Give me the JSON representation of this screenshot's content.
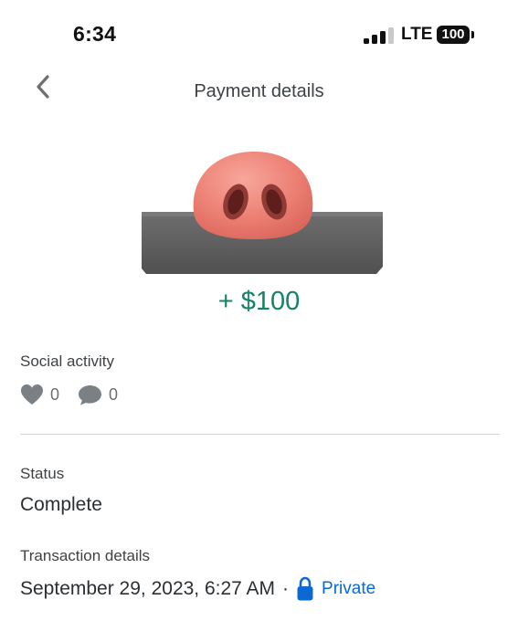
{
  "status_bar": {
    "time": "6:34",
    "network": "LTE",
    "battery": "100",
    "signal_bars_active": 3,
    "signal_bars_total": 4
  },
  "header": {
    "back_icon": "chevron-left-icon",
    "title": "Payment details"
  },
  "payment": {
    "amount": "+ $100",
    "amount_color": "#148467",
    "illustration": "pig-nose-icon"
  },
  "social": {
    "label": "Social activity",
    "likes_icon": "heart-icon",
    "likes": "0",
    "comments_icon": "comment-icon",
    "comments": "0"
  },
  "status": {
    "label": "Status",
    "value": "Complete"
  },
  "transaction": {
    "label": "Transaction details",
    "date": "September 29, 2023, 6:27 AM",
    "separator": "·",
    "privacy_icon": "lock-icon",
    "privacy": "Private",
    "privacy_color": "#0b6ad2"
  }
}
